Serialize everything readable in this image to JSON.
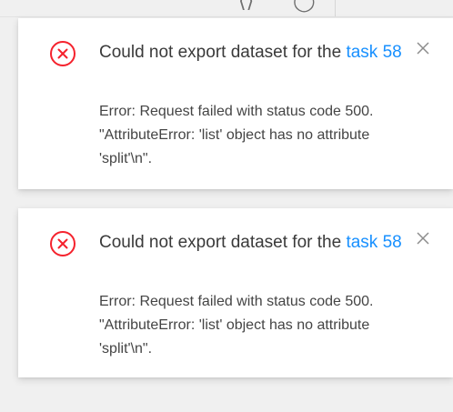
{
  "colors": {
    "error": "#f5222d",
    "link": "#1890ff",
    "text": "#3a3a3a",
    "close": "#8c8c8c"
  },
  "notifications": [
    {
      "icon": "close-circle-icon",
      "title_prefix": "Could not export dataset for the ",
      "title_link": "task 58",
      "description_line1": "Error: Request failed with status code 500.",
      "description_line2": "\"AttributeError: 'list' object has no attribute",
      "description_line3": "'split'\\n\"."
    },
    {
      "icon": "close-circle-icon",
      "title_prefix": "Could not export dataset for the ",
      "title_link": "task 58",
      "description_line1": "Error: Request failed with status code 500.",
      "description_line2": "\"AttributeError: 'list' object has no attribute",
      "description_line3": "'split'\\n\"."
    }
  ]
}
